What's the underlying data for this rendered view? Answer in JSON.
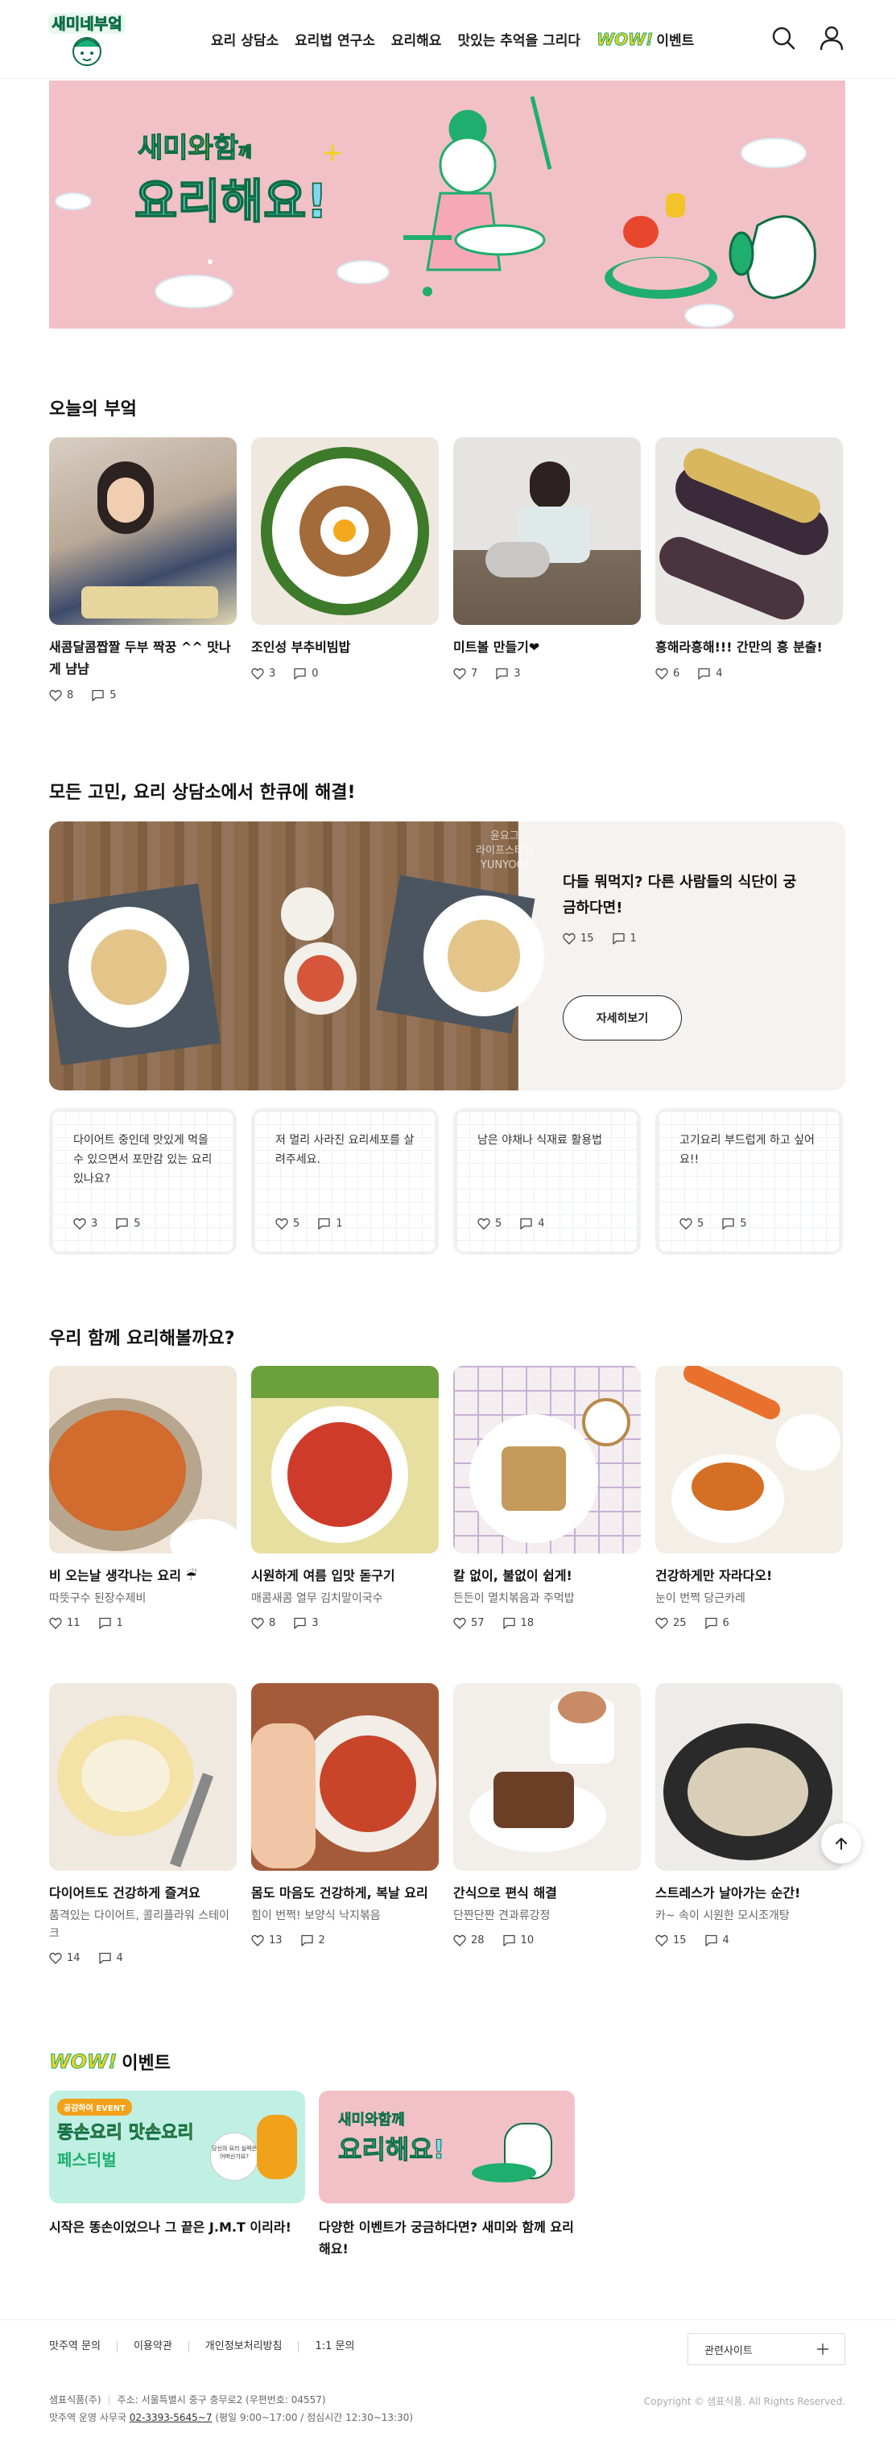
{
  "header": {
    "logo_text": "새미네부엌",
    "nav": [
      "요리 상담소",
      "요리법 연구소",
      "요리해요",
      "맛있는 추억을 그리다"
    ],
    "event_wow": "WOW!",
    "event_label": "이벤트",
    "search_icon": "search-icon",
    "user_icon": "user-icon"
  },
  "banner": {
    "line1_a": "새미",
    "line1_b": "와",
    "line1_c": "함",
    "line1_d": "께",
    "line2": "요리해요!",
    "bg": "#f2c1c7",
    "accent": "#1fae6e"
  },
  "today": {
    "title": "오늘의 부엌",
    "cards": [
      {
        "title": "새콤달콤짭짤 두부 짝꿍 ^^ 맛나게 냠냠",
        "likes": "8",
        "comments": "5"
      },
      {
        "title": "조인성 부추비빔밥",
        "likes": "3",
        "comments": "0"
      },
      {
        "title": "미트볼 만들기❤",
        "likes": "7",
        "comments": "3"
      },
      {
        "title": "흥해라흥해!!! 간만의 흥 분출!",
        "likes": "6",
        "comments": "4"
      }
    ]
  },
  "consult": {
    "title": "모든 고민, 요리 상담소에서 한큐에 해결!",
    "feature_title": "다들 뭐먹지? 다른 사람들의 식단이 궁금하다면!",
    "watermark": "윤요그\n라이프스타일\nYUNYOG!",
    "likes": "15",
    "comments": "1",
    "button": "자세히보기",
    "questions": [
      {
        "text": "다이어트 중인데 맛있게 먹을 수 있으면서 포만감 있는 요리 있나요?",
        "likes": "3",
        "comments": "5"
      },
      {
        "text": "저 멀리 사라진 요리세포를 살려주세요.",
        "likes": "5",
        "comments": "1"
      },
      {
        "text": "남은 야채나 식재료 활용법",
        "likes": "5",
        "comments": "4"
      },
      {
        "text": "고기요리 부드럽게 하고 싶어요!!",
        "likes": "5",
        "comments": "5"
      }
    ]
  },
  "together": {
    "title": "우리 함께 요리해볼까요?",
    "cards": [
      {
        "title": "비 오는날 생각나는 요리 ☔",
        "sub": "따뜻구수 된장수제비",
        "likes": "11",
        "comments": "1"
      },
      {
        "title": "시원하게 여름 입맛 돋구기",
        "sub": "매콤새콤 열무 김치말이국수",
        "likes": "8",
        "comments": "3"
      },
      {
        "title": "칼 없이, 불없이 쉽게!",
        "sub": "든든이 멸치볶음과 주먹밥",
        "likes": "57",
        "comments": "18"
      },
      {
        "title": "건강하게만 자라다오!",
        "sub": "눈이 번쩍 당근카레",
        "likes": "25",
        "comments": "6"
      },
      {
        "title": "다이어트도 건강하게 즐겨요",
        "sub": "품격있는 다이어트, 콜리플라워 스테이크",
        "likes": "14",
        "comments": "4"
      },
      {
        "title": "몸도 마음도 건강하게, 복날 요리",
        "sub": "힘이 번쩍! 보양식 낙지볶음",
        "likes": "13",
        "comments": "2"
      },
      {
        "title": "간식으로 편식 해결",
        "sub": "단짠단짠 견과류강정",
        "likes": "28",
        "comments": "10"
      },
      {
        "title": "스트레스가 날아가는 순간!",
        "sub": "카~ 속이 시원한 모시조개탕",
        "likes": "15",
        "comments": "4"
      }
    ]
  },
  "events": {
    "wow": "WOW!",
    "title": "이벤트",
    "cards": [
      {
        "title": "시작은 똥손이었으나 그 끝은 J.M.T 이리라!",
        "badge": "공감하여 EVENT",
        "line1": "똥손요리 맛손요리",
        "line2": "페스티벌",
        "bubble": "당신의 요리 실력은 어떠신가요?"
      },
      {
        "title": "다양한 이벤트가 궁금하다면? 새미와 함께 요리해요!",
        "line1": "새미와함께",
        "line2": "요리해요!"
      }
    ]
  },
  "footer": {
    "links": [
      "맛주역 문의",
      "이용약관",
      "개인정보처리방침",
      "1:1 문의"
    ],
    "related": "관련사이트",
    "company": "샘표식품(주)",
    "address": "주소: 서울특별시 중구 충무로2 (우편번호: 04557)",
    "ops": "맛주역 운영 사무국",
    "phone": "02-3393-5645~7",
    "hours": "(평일 9:00~17:00 / 점심시간 12:30~13:30)",
    "copyright": "Copyright © 샘표식품. All Rights Reserved."
  }
}
